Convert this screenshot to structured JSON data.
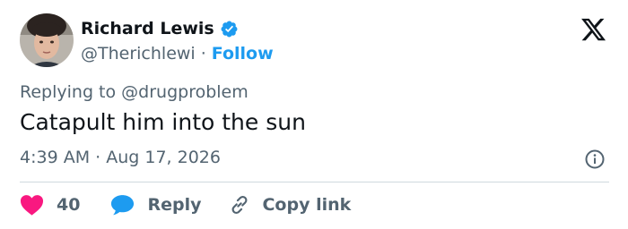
{
  "author": {
    "display_name": "Richard Lewis",
    "handle": "@Therichlewi",
    "separator": "·",
    "follow_label": "Follow",
    "verified": true
  },
  "brand": {
    "logo_icon": "x-logo-icon"
  },
  "tweet": {
    "replying_to": "Replying to @drugproblem",
    "text": "Catapult him into the sun",
    "timestamp": "4:39 AM · Aug 17, 2026"
  },
  "actions": {
    "like_count": "40",
    "reply_label": "Reply",
    "copy_link_label": "Copy link"
  },
  "colors": {
    "accent": "#1d9bf0",
    "like": "#f91880",
    "text_primary": "#0f1419",
    "text_secondary": "#536471",
    "divider": "#cfd9de"
  }
}
